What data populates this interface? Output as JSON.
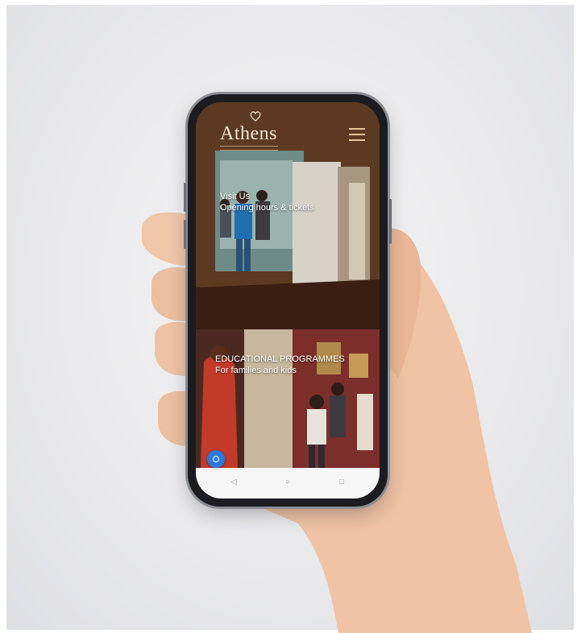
{
  "app": {
    "logo_text": "Athens",
    "menu_icon": "hamburger-menu-icon"
  },
  "hero": {
    "line1": "Visit Us",
    "line2": "Opening hours & tickets"
  },
  "programs": {
    "line1": "EDUCATIONAL PROGRAMMES",
    "line2": "For families and kids"
  },
  "fab": {
    "icon": "accessibility-icon"
  },
  "nav": {
    "back_icon": "back-icon",
    "home_icon": "home-icon",
    "recent_icon": "recent-apps-icon"
  },
  "colors": {
    "accent": "#2a7ae0",
    "logo": "#f3e6d2",
    "menu": "#e3c79a"
  }
}
